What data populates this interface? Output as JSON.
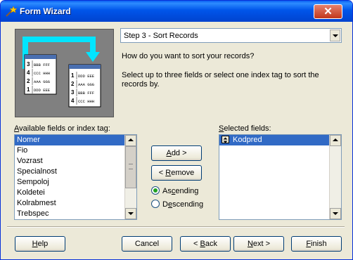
{
  "window": {
    "title": "Form Wizard"
  },
  "step": {
    "selected": "Step 3 - Sort Records"
  },
  "instructions": {
    "question": "How do you want to sort your records?",
    "detail": "Select up to three fields or select one index tag to sort the records by."
  },
  "available": {
    "label_prefix": "",
    "label_mnemonic": "A",
    "label_rest": "vailable fields or index tag:",
    "items": [
      "Nomer",
      "Fio",
      "Vozrast",
      "Specialnost",
      "Sempoloj",
      "Koldetei",
      "Kolrabmest",
      "Trebspec"
    ],
    "selected_index": 0
  },
  "selected_fields": {
    "label_prefix": "",
    "label_mnemonic": "S",
    "label_rest": "elected fields:",
    "items": [
      "Kodpred"
    ]
  },
  "actions": {
    "add": {
      "mnemonic": "A",
      "rest": "dd >"
    },
    "remove": {
      "prefix": "< ",
      "mnemonic": "R",
      "rest": "emove"
    }
  },
  "sort_order": {
    "ascending": {
      "prefix": "As",
      "mnemonic": "c",
      "rest": "ending",
      "checked": true
    },
    "descending": {
      "prefix": "D",
      "mnemonic": "e",
      "rest": "scending",
      "checked": false
    }
  },
  "footer": {
    "help": {
      "mnemonic": "H",
      "rest": "elp"
    },
    "cancel": "Cancel",
    "back": {
      "prefix": "< ",
      "mnemonic": "B",
      "rest": "ack"
    },
    "next": {
      "mnemonic": "N",
      "rest": "ext >"
    },
    "finish": {
      "mnemonic": "F",
      "rest": "inish"
    }
  },
  "illustration": {
    "left_rows": [
      {
        "num": "3",
        "text": "BBB FFF"
      },
      {
        "num": "4",
        "text": "CCC HHH"
      },
      {
        "num": "2",
        "text": "AAA GGG"
      },
      {
        "num": "1",
        "text": "DDD EEE"
      }
    ],
    "right_rows": [
      {
        "num": "1",
        "text": "DDD EEE"
      },
      {
        "num": "2",
        "text": "AAA GGG"
      },
      {
        "num": "3",
        "text": "BBB FFF"
      },
      {
        "num": "4",
        "text": "CCC HHH"
      }
    ]
  },
  "colors": {
    "title_bar": "#0055ea",
    "selection": "#316ac5",
    "window_bg": "#ece9d8",
    "arrow": "#00e5ff"
  }
}
